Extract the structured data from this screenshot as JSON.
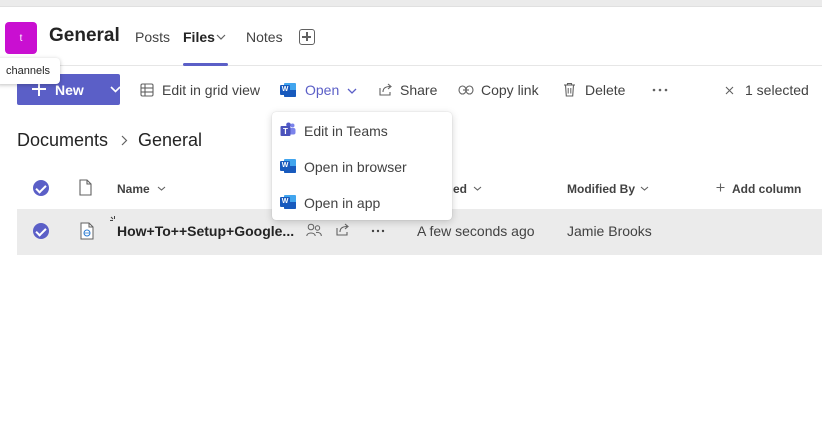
{
  "header": {
    "avatar_letter": "t",
    "channel_name": "General",
    "tabs": [
      {
        "label": "Posts"
      },
      {
        "label": "Files"
      },
      {
        "label": "Notes"
      }
    ],
    "tooltip": "channels"
  },
  "toolbar": {
    "new_label": "New",
    "edit_grid_label": "Edit in grid view",
    "open_label": "Open",
    "share_label": "Share",
    "copy_link_label": "Copy link",
    "delete_label": "Delete",
    "selected_label": "1 selected"
  },
  "open_menu": {
    "items": [
      {
        "label": "Edit in Teams",
        "icon": "teams-icon"
      },
      {
        "label": "Open in browser",
        "icon": "word-icon"
      },
      {
        "label": "Open in app",
        "icon": "word-icon"
      }
    ]
  },
  "breadcrumb": {
    "root": "Documents",
    "current": "General"
  },
  "table": {
    "columns": {
      "name": "Name",
      "modified_partial": "ed",
      "modified_by": "Modified By",
      "add_column": "Add column"
    },
    "rows": [
      {
        "name": "How+To++Setup+Google...",
        "modified": "A few seconds ago",
        "modified_by": "Jamie Brooks",
        "selected": true
      }
    ]
  },
  "colors": {
    "accent": "#5b5fc7",
    "team_avatar": "#c90fd1",
    "row_selected": "#ebebeb"
  }
}
